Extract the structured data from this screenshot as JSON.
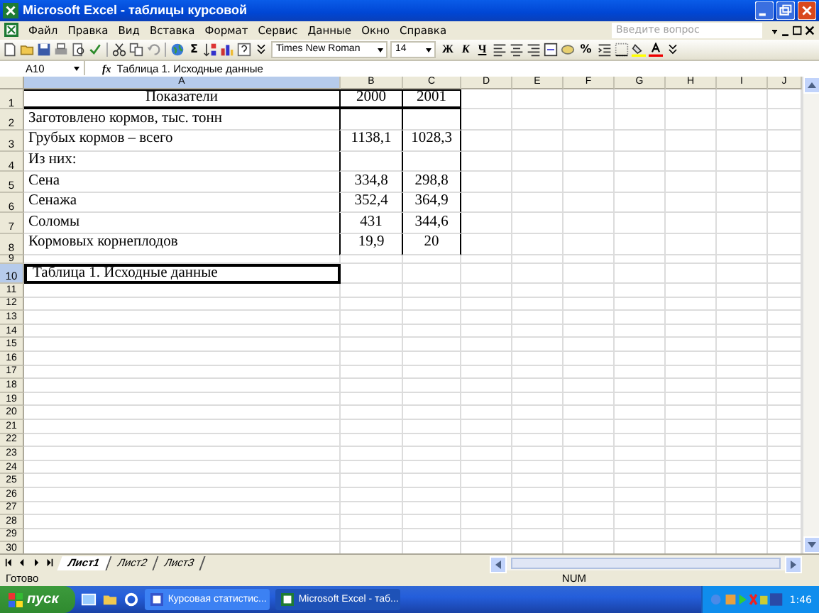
{
  "window": {
    "title": "Microsoft Excel - таблицы курсовой"
  },
  "menu": [
    "Файл",
    "Правка",
    "Вид",
    "Вставка",
    "Формат",
    "Сервис",
    "Данные",
    "Окно",
    "Справка"
  ],
  "help_search": {
    "placeholder": "Введите вопрос"
  },
  "toolbar": {
    "sum": "Σ",
    "font": "Times New Roman",
    "size": "14",
    "format_buttons": [
      "Ж",
      "К",
      "Ч"
    ],
    "percent": "%"
  },
  "formula_bar": {
    "name_box": "A10",
    "fx": "fx",
    "value": "Таблица 1. Исходные данные"
  },
  "columns": [
    {
      "label": "A",
      "selected": true
    },
    {
      "label": "B",
      "selected": false
    },
    {
      "label": "C",
      "selected": false
    },
    {
      "label": "D",
      "selected": false
    },
    {
      "label": "E",
      "selected": false
    },
    {
      "label": "F",
      "selected": false
    },
    {
      "label": "G",
      "selected": false
    },
    {
      "label": "H",
      "selected": false
    },
    {
      "label": "I",
      "selected": false
    },
    {
      "label": "J",
      "selected": false
    }
  ],
  "rows": [
    {
      "header": "1",
      "kind": "table_header",
      "selected": false,
      "cells": [
        "Показатели",
        "2000",
        "2001"
      ]
    },
    {
      "header": "2",
      "kind": "table_body",
      "selected": false,
      "cells": [
        "Заготовлено кормов, тыс. тонн"
      ]
    },
    {
      "header": "3",
      "kind": "table_body",
      "selected": false,
      "cells": [
        "Грубых кормов – всего",
        "1138,1",
        "1028,3"
      ]
    },
    {
      "header": "4",
      "kind": "table_body",
      "selected": false,
      "cells": [
        "Из них:"
      ]
    },
    {
      "header": "5",
      "kind": "table_body",
      "selected": false,
      "cells": [
        "Сена",
        "334,8",
        "298,8"
      ]
    },
    {
      "header": "6",
      "kind": "table_body",
      "selected": false,
      "cells": [
        "Сенажа",
        "352,4",
        "364,9"
      ]
    },
    {
      "header": "7",
      "kind": "table_body",
      "selected": false,
      "cells": [
        "Соломы",
        "431",
        "344,6"
      ]
    },
    {
      "header": "8",
      "kind": "table_body",
      "selected": false,
      "cells": [
        "Кормовых корнеплодов",
        "19,9",
        "20"
      ]
    },
    {
      "header": "9",
      "kind": "spacer",
      "selected": false
    },
    {
      "header": "10",
      "kind": "plain",
      "selected": true,
      "cells": [
        "Таблица 1. Исходные данные"
      ]
    },
    {
      "header": "11",
      "kind": "small",
      "selected": false
    },
    {
      "header": "12",
      "kind": "small",
      "selected": false
    },
    {
      "header": "13",
      "kind": "small",
      "selected": false
    },
    {
      "header": "14",
      "kind": "small",
      "selected": false
    },
    {
      "header": "15",
      "kind": "small",
      "selected": false
    },
    {
      "header": "16",
      "kind": "small",
      "selected": false
    },
    {
      "header": "17",
      "kind": "small",
      "selected": false
    },
    {
      "header": "18",
      "kind": "small",
      "selected": false
    },
    {
      "header": "19",
      "kind": "small",
      "selected": false
    },
    {
      "header": "20",
      "kind": "small",
      "selected": false
    },
    {
      "header": "21",
      "kind": "small",
      "selected": false
    },
    {
      "header": "22",
      "kind": "small",
      "selected": false
    },
    {
      "header": "23",
      "kind": "small",
      "selected": false
    },
    {
      "header": "24",
      "kind": "small",
      "selected": false
    },
    {
      "header": "25",
      "kind": "small",
      "selected": false
    },
    {
      "header": "26",
      "kind": "small",
      "selected": false
    },
    {
      "header": "27",
      "kind": "small",
      "selected": false
    },
    {
      "header": "28",
      "kind": "small",
      "selected": false
    },
    {
      "header": "29",
      "kind": "small",
      "selected": false
    },
    {
      "header": "30",
      "kind": "small",
      "selected": false
    }
  ],
  "sheet_tabs": [
    {
      "label": "Лист1",
      "selected": true
    },
    {
      "label": "Лист2",
      "selected": false
    },
    {
      "label": "Лист3",
      "selected": false
    }
  ],
  "status_bar": {
    "text": "Готово",
    "num": "NUM"
  },
  "taskbar": {
    "start": "пуск",
    "tasks": [
      {
        "label": "Курсовая статистис...",
        "selected": false
      },
      {
        "label": "Microsoft Excel - таб...",
        "selected": true
      }
    ],
    "clock": "1:46"
  }
}
